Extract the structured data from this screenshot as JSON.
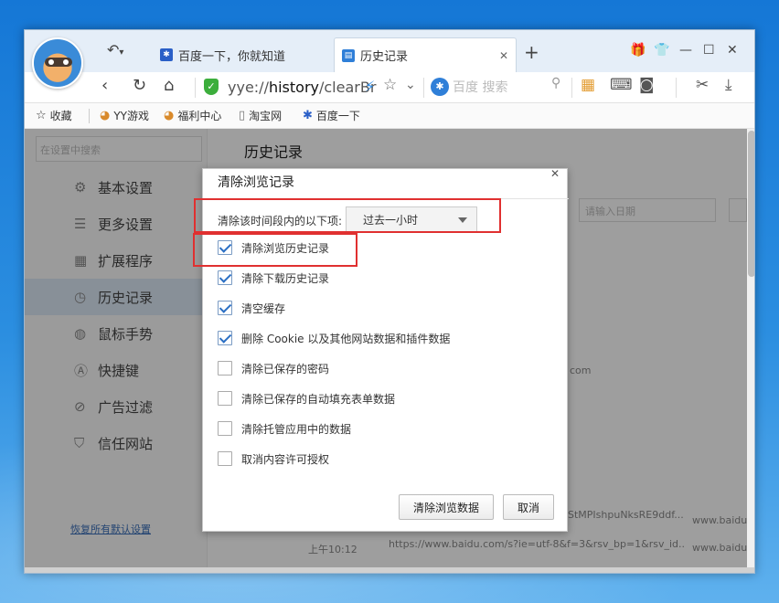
{
  "browser": {
    "tabs": [
      {
        "label": "百度一下，你就知道"
      },
      {
        "label": "历史记录"
      }
    ],
    "address": {
      "scheme": "yye://",
      "host": "history",
      "path": "/clearBr"
    },
    "search_placeholder": "百度 搜索",
    "bookmarks": [
      "收藏",
      "YY游戏",
      "福利中心",
      "淘宝网",
      "百度一下"
    ]
  },
  "settings": {
    "search_placeholder": "在设置中搜索",
    "sidebar": [
      {
        "label": "基本设置",
        "icon": "gear-icon"
      },
      {
        "label": "更多设置",
        "icon": "list-icon"
      },
      {
        "label": "扩展程序",
        "icon": "grid-icon"
      },
      {
        "label": "历史记录",
        "icon": "clock-icon"
      },
      {
        "label": "鼠标手势",
        "icon": "mouse-icon"
      },
      {
        "label": "快捷键",
        "icon": "key-icon"
      },
      {
        "label": "广告过滤",
        "icon": "block-icon"
      },
      {
        "label": "信任网站",
        "icon": "shield-icon"
      }
    ],
    "restore_link": "恢复所有默认设置",
    "page_title": "历史记录",
    "date_placeholder": "请输入日期",
    "bg_rows": [
      {
        "time": "",
        "text": "com"
      },
      {
        "time": "",
        "text": "StMPIshpuNksRE9ddf..."
      },
      {
        "time": "上午10:12",
        "text": "https://www.baidu.com/s?ie=utf-8&f=3&rsv_bp=1&rsv_id..."
      }
    ],
    "bg_domain": "www.baidu"
  },
  "dialog": {
    "title": "清除浏览记录",
    "range_label": "清除该时间段内的以下项:",
    "range_value": "过去一小时",
    "options": [
      {
        "label": "清除浏览历史记录",
        "checked": true
      },
      {
        "label": "清除下载历史记录",
        "checked": true
      },
      {
        "label": "清空缓存",
        "checked": true
      },
      {
        "label": "删除 Cookie 以及其他网站数据和插件数据",
        "checked": true
      },
      {
        "label": "清除已保存的密码",
        "checked": false
      },
      {
        "label": "清除已保存的自动填充表单数据",
        "checked": false
      },
      {
        "label": "清除托管应用中的数据",
        "checked": false
      },
      {
        "label": "取消内容许可授权",
        "checked": false
      }
    ],
    "confirm_button": "清除浏览数据",
    "cancel_button": "取消",
    "highlight_color": "#e03030"
  }
}
